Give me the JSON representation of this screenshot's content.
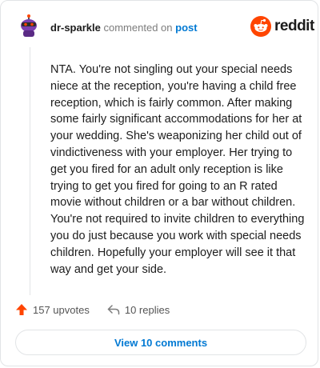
{
  "header": {
    "username": "dr-sparkle",
    "action_text": "commented on",
    "post_link": "post",
    "logo_text": "reddit"
  },
  "comment": {
    "body": "NTA. You're not singling out your special needs niece at the reception, you're having a child free reception, which is fairly common. After making some fairly significant accommodations for her at your wedding. She's weaponizing her child out of vindictiveness with your employer. Her trying to get you fired for an adult only reception is like trying to get you fired for going to an R rated movie without children or a bar without children. You're not required to invite children to everything you do just because you work with special needs children. Hopefully your employer will see it that way and get your side."
  },
  "actions": {
    "upvotes": "157 upvotes",
    "replies": "10 replies"
  },
  "footer": {
    "view_comments": "View 10 comments"
  },
  "colors": {
    "reddit_orange": "#ff4500",
    "link_blue": "#0079d3",
    "avatar_purple": "#7b3fb0"
  },
  "icons": {
    "avatar": "snoo-avatar-icon",
    "logo": "reddit-snoo-icon",
    "upvote": "upvote-arrow-icon",
    "reply": "reply-arrow-icon"
  }
}
